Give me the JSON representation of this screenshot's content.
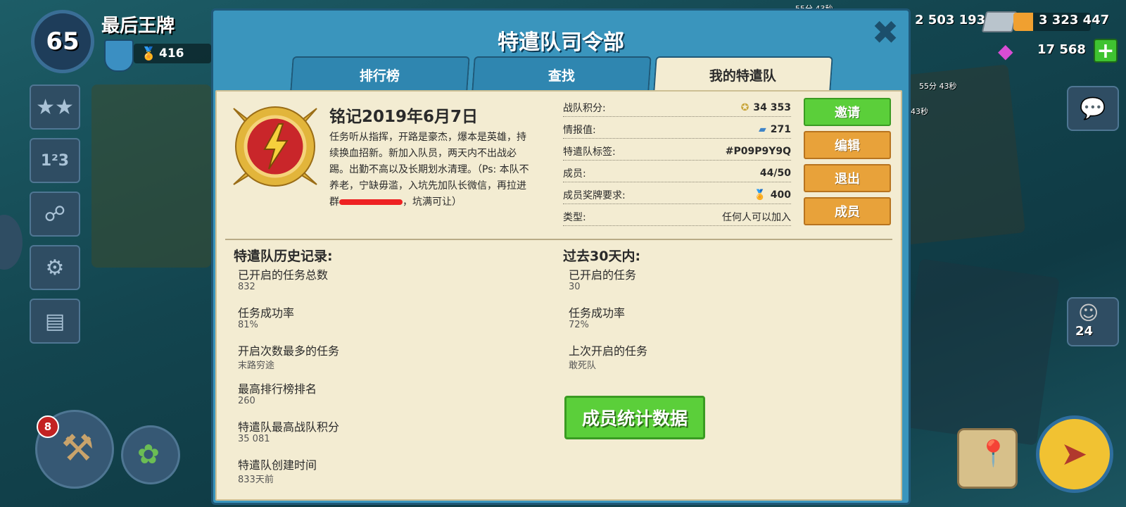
{
  "player": {
    "level": "65",
    "name": "最后王牌",
    "medals": "416"
  },
  "resources": {
    "gold": "2 503 193",
    "steel": "3 323 447",
    "diamonds": "17 568",
    "timer1": "55分 43秒",
    "timer2": "55分 43秒",
    "timer3": "43秒"
  },
  "builder_count": "8",
  "troop_count": "24",
  "dialog": {
    "title": "特遣队司令部",
    "tabs": [
      "排行榜",
      "查找",
      "我的特遣队"
    ],
    "taskforce": {
      "name": "铭记2019年6月7日",
      "description": "任务听从指挥，开路是豪杰，爆本是英雄，持续换血招新。新加入队员，两天内不出战必踢。出勤不高以及长期划水清理。（Ps: 本队不养老，宁缺毋滥，入坑先加队长微信，再拉进群",
      "description_end": "，坑满可让）"
    },
    "stats": [
      {
        "label": "战队积分:",
        "value": "34 353",
        "icon": "emblem-icon"
      },
      {
        "label": "情报值:",
        "value": "271",
        "icon": "intel-icon"
      },
      {
        "label": "特遣队标签:",
        "value": "#P09P9Y9Q",
        "icon": ""
      },
      {
        "label": "成员:",
        "value": "44/50",
        "icon": ""
      },
      {
        "label": "成员奖牌要求:",
        "value": "400",
        "icon": "medal-icon"
      },
      {
        "label": "类型:",
        "value": "任何人可以加入",
        "icon": ""
      }
    ],
    "actions": {
      "invite": "邀请",
      "edit": "编辑",
      "leave": "退出",
      "members": "成员"
    },
    "history": {
      "title": "特遣队历史记录:",
      "items": [
        {
          "label": "已开启的任务总数",
          "value": "832"
        },
        {
          "label": "任务成功率",
          "value": "81%"
        },
        {
          "label": "开启次数最多的任务",
          "value": "末路穷途"
        },
        {
          "label": "最高排行榜排名",
          "value": "260"
        },
        {
          "label": "特遣队最高战队积分",
          "value": "35 081"
        },
        {
          "label": "特遣队创建时间",
          "value": "833天前"
        }
      ]
    },
    "last30": {
      "title": "过去30天内:",
      "items": [
        {
          "label": "已开启的任务",
          "value": "30"
        },
        {
          "label": "任务成功率",
          "value": "72%"
        },
        {
          "label": "上次开启的任务",
          "value": "敢死队"
        }
      ]
    },
    "member_stats_button": "成员统计数据"
  }
}
